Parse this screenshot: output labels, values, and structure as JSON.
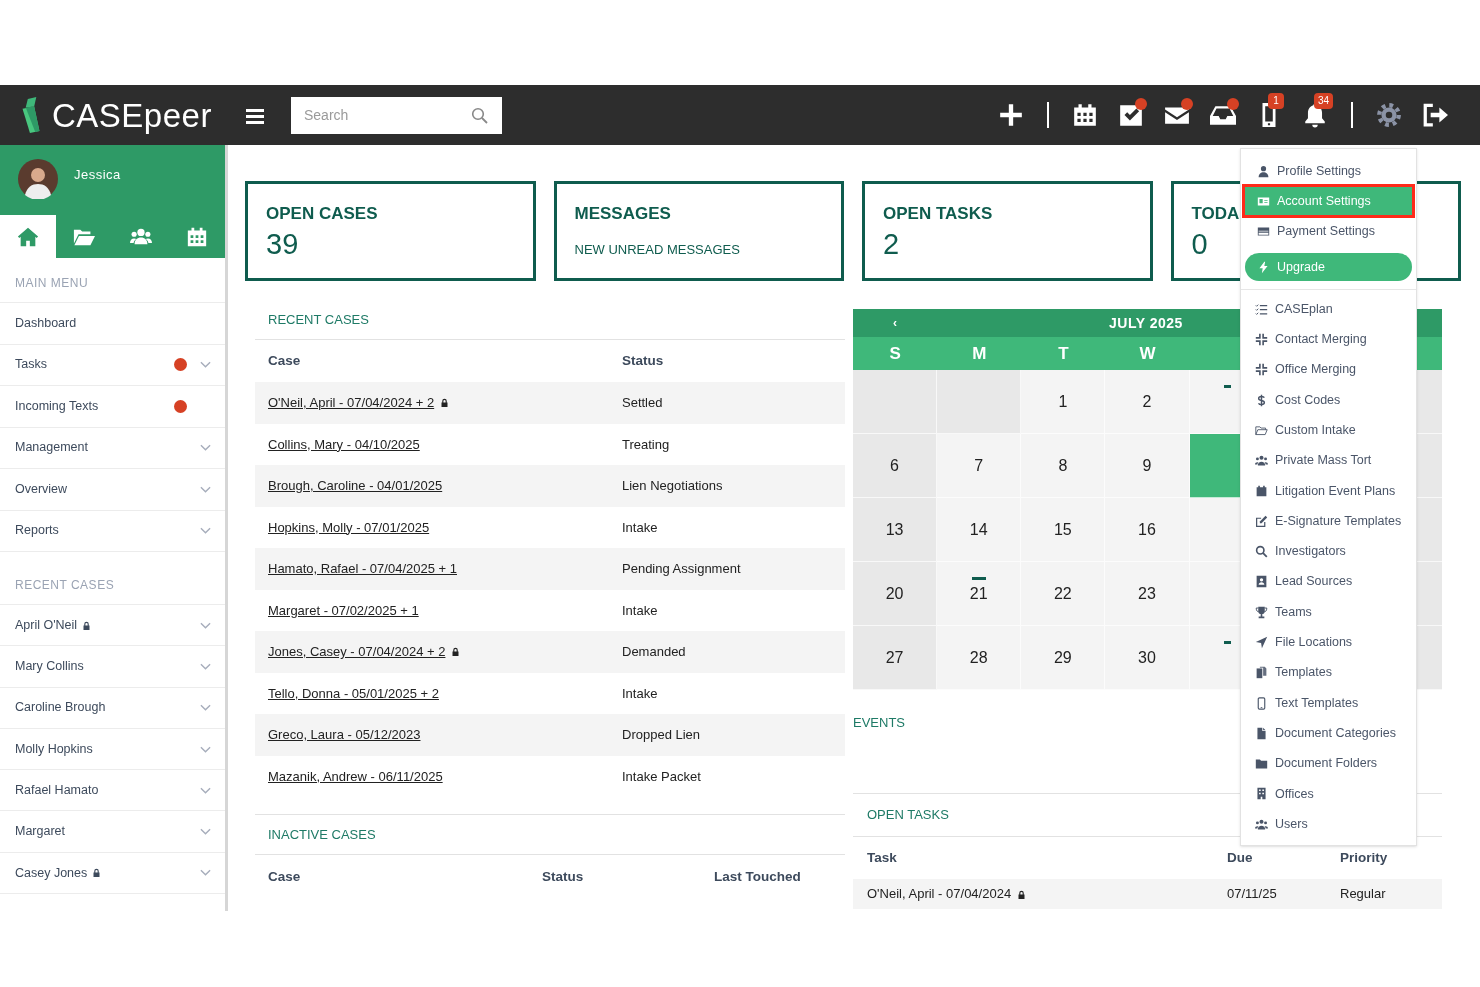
{
  "top_bar": {
    "logo": "CASEpeer",
    "search": {
      "placeholder": "Search"
    },
    "icons": [
      {
        "kind": "plus"
      },
      {
        "kind": "divider"
      },
      {
        "kind": "calendar"
      },
      {
        "kind": "tasks",
        "dot": true
      },
      {
        "kind": "mail",
        "dot": true
      },
      {
        "kind": "inbox",
        "dot": true
      },
      {
        "kind": "phone",
        "badge": "1"
      },
      {
        "kind": "bell",
        "badge": "34"
      },
      {
        "kind": "divider"
      },
      {
        "kind": "gear",
        "active": true
      },
      {
        "kind": "signout"
      }
    ]
  },
  "sidebar": {
    "user": {
      "name": "Jessica"
    },
    "tabs": [
      {
        "kind": "home",
        "selected": true
      },
      {
        "kind": "folder",
        "selected": false
      },
      {
        "kind": "users",
        "selected": false
      },
      {
        "kind": "calendar",
        "selected": false
      }
    ],
    "main_menu": {
      "heading": "MAIN MENU",
      "items": [
        {
          "label": "Dashboard",
          "dot": false,
          "expandable": false
        },
        {
          "label": "Tasks",
          "dot": true,
          "expandable": true
        },
        {
          "label": "Incoming Texts",
          "dot": true,
          "expandable": false
        },
        {
          "label": "Management",
          "dot": false,
          "expandable": true
        },
        {
          "label": "Overview",
          "dot": false,
          "expandable": true
        },
        {
          "label": "Reports",
          "dot": false,
          "expandable": true
        }
      ]
    },
    "recent_cases": {
      "heading": "RECENT CASES",
      "items": [
        {
          "label": "April O'Neil",
          "locked": true
        },
        {
          "label": "Mary Collins",
          "locked": false
        },
        {
          "label": "Caroline Brough",
          "locked": false
        },
        {
          "label": "Molly Hopkins",
          "locked": false
        },
        {
          "label": "Rafael Hamato",
          "locked": false
        },
        {
          "label": "Margaret",
          "locked": false
        },
        {
          "label": "Casey Jones",
          "locked": true
        }
      ]
    }
  },
  "cards": [
    {
      "title": "OPEN CASES",
      "value": "39"
    },
    {
      "title": "MESSAGES",
      "subtitle": "NEW UNREAD MESSAGES"
    },
    {
      "title": "OPEN TASKS",
      "value": "2"
    },
    {
      "title": "TODA",
      "value": "0"
    }
  ],
  "recent_cases": {
    "title": "RECENT CASES",
    "columns": [
      "Case",
      "Status"
    ],
    "rows": [
      {
        "case": "O'Neil, April - 07/04/2024 + 2",
        "locked": true,
        "status": "Settled"
      },
      {
        "case": "Collins, Mary - 04/10/2025",
        "locked": false,
        "status": "Treating"
      },
      {
        "case": "Brough, Caroline - 04/01/2025",
        "locked": false,
        "status": "Lien Negotiations"
      },
      {
        "case": "Hopkins, Molly - 07/01/2025",
        "locked": false,
        "status": "Intake"
      },
      {
        "case": "Hamato, Rafael - 07/04/2025 + 1",
        "locked": false,
        "status": "Pending Assignment"
      },
      {
        "case": "Margaret - 07/02/2025 + 1",
        "locked": false,
        "status": "Intake"
      },
      {
        "case": "Jones, Casey - 07/04/2024 + 2",
        "locked": true,
        "status": "Demanded"
      },
      {
        "case": "Tello, Donna - 05/01/2025 + 2",
        "locked": false,
        "status": "Intake"
      },
      {
        "case": "Greco, Laura - 05/12/2023",
        "locked": false,
        "status": "Dropped Lien"
      },
      {
        "case": "Mazanik, Andrew - 06/11/2025",
        "locked": false,
        "status": "Intake Packet"
      }
    ]
  },
  "inactive_cases": {
    "title": "INACTIVE CASES",
    "columns": [
      "Case",
      "Status",
      "Last Touched"
    ]
  },
  "calendar": {
    "prev": "‹",
    "month": "JULY 2025",
    "weekdays": [
      "S",
      "M",
      "T",
      "W"
    ],
    "weeks": [
      {
        "days": [
          {
            "blank": true
          },
          {
            "blank": true
          },
          {
            "day": "1",
            "event": false
          },
          {
            "day": "2",
            "event": false
          }
        ],
        "partial_day": {
          "selected": false,
          "event": true
        }
      },
      {
        "days": [
          {
            "day": "6",
            "event": false
          },
          {
            "day": "7",
            "event": false
          },
          {
            "day": "8",
            "event": false
          },
          {
            "day": "9",
            "event": false
          }
        ],
        "partial_day": {
          "selected": true,
          "event": false
        }
      },
      {
        "days": [
          {
            "day": "13",
            "event": false
          },
          {
            "day": "14",
            "event": false
          },
          {
            "day": "15",
            "event": false
          },
          {
            "day": "16",
            "event": false
          }
        ],
        "partial_day": {
          "selected": false,
          "event": false
        }
      },
      {
        "days": [
          {
            "day": "20",
            "event": false
          },
          {
            "day": "21",
            "event": true
          },
          {
            "day": "22",
            "event": false
          },
          {
            "day": "23",
            "event": false
          }
        ],
        "partial_day": {
          "selected": false,
          "event": false
        }
      },
      {
        "days": [
          {
            "day": "27",
            "event": false
          },
          {
            "day": "28",
            "event": false
          },
          {
            "day": "29",
            "event": false
          },
          {
            "day": "30",
            "event": false
          }
        ],
        "partial_day": {
          "selected": false,
          "event": true
        }
      }
    ]
  },
  "events": {
    "title": "EVENTS"
  },
  "open_tasks": {
    "title": "OPEN TASKS",
    "columns": [
      "Task",
      "Due",
      "Priority"
    ],
    "rows": [
      {
        "task": "O'Neil, April - 07/04/2024",
        "locked": true,
        "due": "07/11/25",
        "priority": "Regular"
      }
    ]
  },
  "settings_menu": {
    "top_items": [
      {
        "label": "Profile Settings",
        "kind": "user",
        "selected": false,
        "highlighted": false
      },
      {
        "label": "Account Settings",
        "kind": "idcard",
        "selected": true,
        "highlighted": true
      },
      {
        "label": "Payment Settings",
        "kind": "card",
        "selected": false,
        "highlighted": false
      }
    ],
    "upgrade": {
      "label": "Upgrade"
    },
    "items": [
      {
        "label": "CASEplan",
        "kind": "list"
      },
      {
        "label": "Contact Merging",
        "kind": "compress"
      },
      {
        "label": "Office Merging",
        "kind": "compress"
      },
      {
        "label": "Cost Codes",
        "kind": "dollar"
      },
      {
        "label": "Custom Intake",
        "kind": "folderopen"
      },
      {
        "label": "Private Mass Tort",
        "kind": "users"
      },
      {
        "label": "Litigation Event Plans",
        "kind": "calendar"
      },
      {
        "label": "E-Signature Templates",
        "kind": "edit"
      },
      {
        "label": "Investigators",
        "kind": "search"
      },
      {
        "label": "Lead Sources",
        "kind": "addressbook"
      },
      {
        "label": "Teams",
        "kind": "trophy"
      },
      {
        "label": "File Locations",
        "kind": "arrow"
      },
      {
        "label": "Templates",
        "kind": "copy"
      },
      {
        "label": "Text Templates",
        "kind": "mobile"
      },
      {
        "label": "Document Categories",
        "kind": "file"
      },
      {
        "label": "Document Folders",
        "kind": "folder"
      },
      {
        "label": "Offices",
        "kind": "building"
      },
      {
        "label": "Users",
        "kind": "users"
      }
    ]
  }
}
